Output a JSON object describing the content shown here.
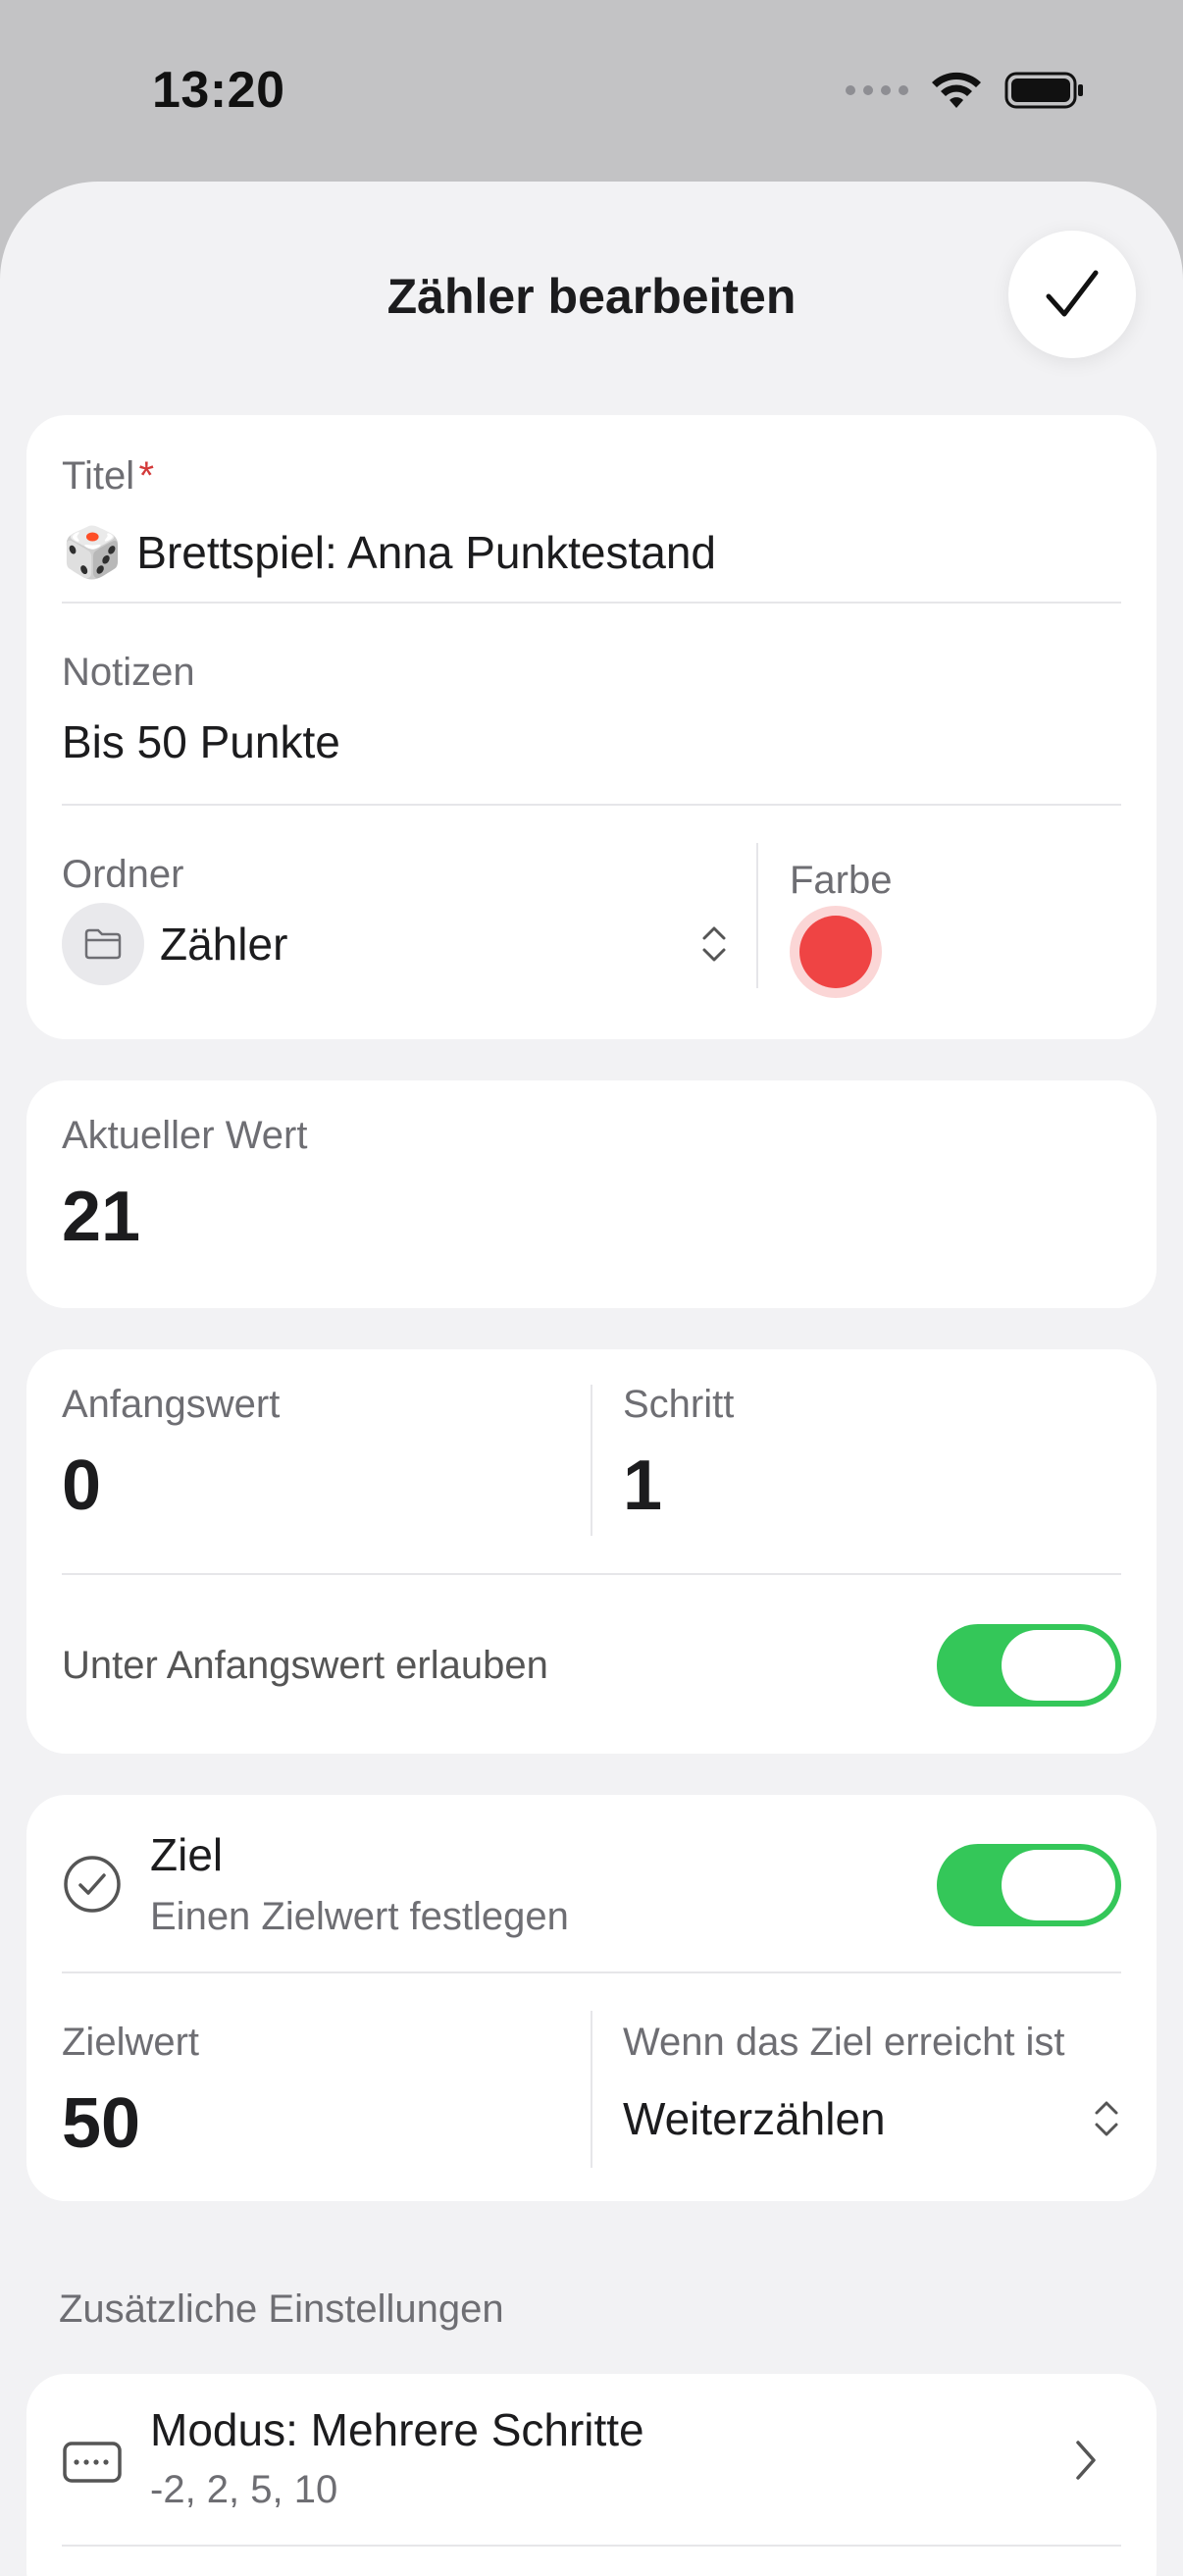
{
  "status_bar": {
    "time": "13:20"
  },
  "header": {
    "title": "Zähler bearbeiten"
  },
  "card_details": {
    "title_label": "Titel",
    "required_mark": "*",
    "title_emoji": "🎲",
    "title_value": "Brettspiel: Anna Punktestand",
    "notes_label": "Notizen",
    "notes_value": "Bis 50 Punkte",
    "folder_label": "Ordner",
    "folder_value": "Zähler",
    "color_label": "Farbe",
    "color_value": "#ef4444"
  },
  "card_current": {
    "label": "Aktueller Wert",
    "value": "21"
  },
  "card_start": {
    "start_label": "Anfangswert",
    "start_value": "0",
    "step_label": "Schritt",
    "step_value": "1",
    "allow_below_label": "Unter Anfangswert erlauben",
    "allow_below_on": true
  },
  "card_goal": {
    "goal_title": "Ziel",
    "goal_subtitle": "Einen Zielwert festlegen",
    "goal_on": true,
    "target_label": "Zielwert",
    "target_value": "50",
    "when_reached_label": "Wenn das Ziel erreicht ist",
    "when_reached_value": "Weiterzählen"
  },
  "additional": {
    "section_title": "Zusätzliche Einstellungen",
    "mode_title": "Modus: Mehrere Schritte",
    "mode_subtitle": "-2, 2, 5, 10"
  },
  "colors": {
    "accent_green": "#34c759",
    "required_red": "#d33a3a"
  }
}
